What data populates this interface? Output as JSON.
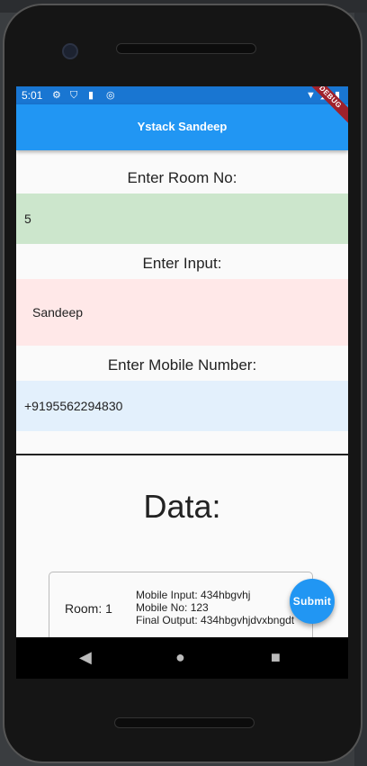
{
  "status_bar": {
    "time": "5:01",
    "icons": [
      "gear-icon",
      "shield-icon",
      "sd-card-icon",
      "sync-icon",
      "wifi-icon",
      "signal-icon",
      "battery-icon"
    ]
  },
  "app_bar": {
    "title": "Ystack Sandeep",
    "debug_banner": "DEBUG"
  },
  "form": {
    "room_label": "Enter Room No:",
    "room_value": "5",
    "input_label": "Enter Input:",
    "input_value": "Sandeep",
    "mobile_label": "Enter Mobile Number:",
    "mobile_value": "+9195562294830"
  },
  "data_section": {
    "heading": "Data:",
    "card": {
      "room": "Room: 1",
      "mobile_input": "Mobile Input: 434hbgvhj",
      "mobile_no": "Mobile No: 123",
      "final_output": "Final Output: 434hbgvhjdvxbngdt"
    }
  },
  "fab": {
    "label": "Submit"
  },
  "colors": {
    "primary": "#2196f3",
    "status_bar": "#1976d2",
    "room_field_bg": "#cce6cc",
    "input_field_bg": "#ffe8e8",
    "mobile_field_bg": "#e3f0fc"
  }
}
